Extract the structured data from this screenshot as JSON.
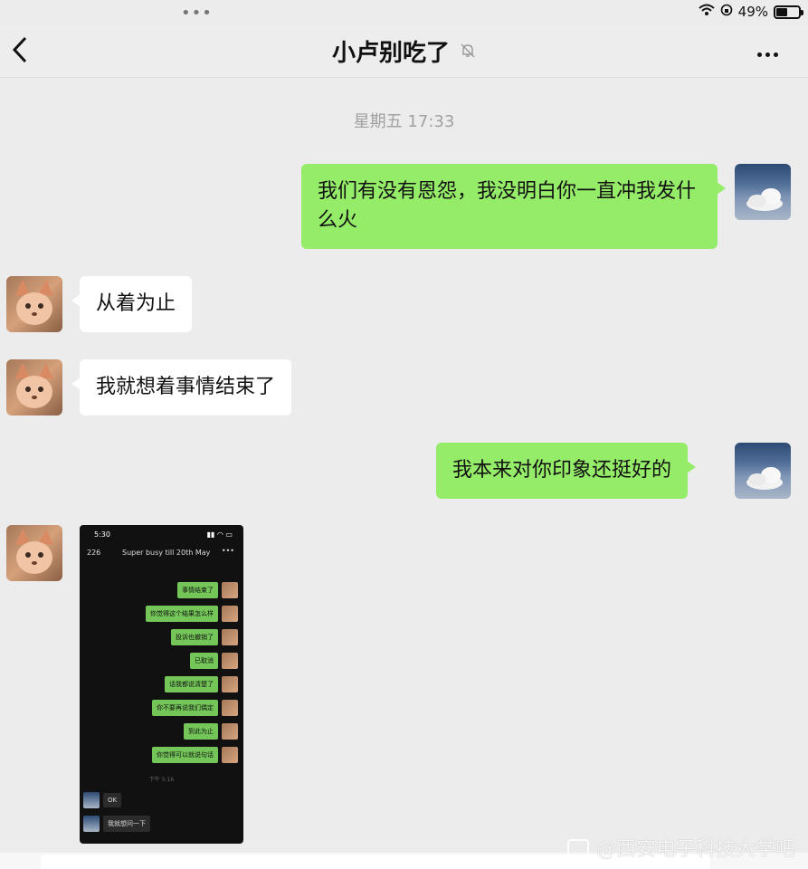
{
  "status": {
    "battery": "49%"
  },
  "header": {
    "title": "小卢别吃了"
  },
  "chat": {
    "timestamp": "星期五 17:33",
    "messages": [
      {
        "side": "me",
        "text": "我们有没有恩怨，我没明白你一直冲我发什么火"
      },
      {
        "side": "them",
        "text": "从着为止"
      },
      {
        "side": "them",
        "text": "我就想着事情结束了"
      },
      {
        "side": "me",
        "text": "我本来对你印象还挺好的"
      }
    ]
  },
  "screenshot_message": {
    "status_time": "5:30",
    "nav_back": "226",
    "nav_title": "Super busy till 20th May",
    "right_messages": [
      "事情结束了",
      "你觉得这个结果怎么样",
      "投诉也撤销了",
      "已取消",
      "话我都说清楚了",
      "你不要再说我们偶定",
      "到此为止",
      "你觉得可以就说句话"
    ],
    "time": "下午 5:16",
    "left_messages": [
      "OK",
      "我就想问一下"
    ]
  },
  "watermark": {
    "text": "@西安电子科技大学吧"
  },
  "colors": {
    "chat_background": "#ececec",
    "my_bubble": "#95ec69",
    "their_bubble": "#ffffff"
  }
}
